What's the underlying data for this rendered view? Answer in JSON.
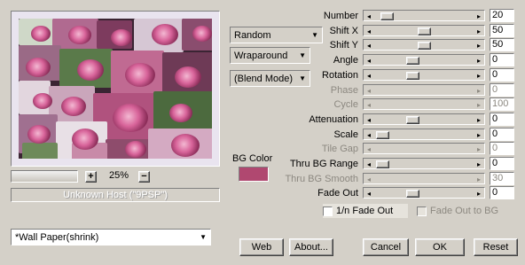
{
  "preview": {
    "zoom": "25%",
    "host_status": "Unknown Host (\"9PSP\")"
  },
  "controls": {
    "mode": "Random",
    "edge": "Wraparound",
    "blend": "(Blend Mode)",
    "bg_color_label": "BG Color",
    "bg_color": "#b04870",
    "preset": "*Wall Paper(shrink)"
  },
  "params": [
    {
      "label": "Number",
      "value": "20",
      "level": 0.05,
      "enabled": true
    },
    {
      "label": "Shift X",
      "value": "50",
      "level": 0.5,
      "enabled": true
    },
    {
      "label": "Shift Y",
      "value": "50",
      "level": 0.5,
      "enabled": true
    },
    {
      "label": "Angle",
      "value": "0",
      "level": 0.37,
      "enabled": true
    },
    {
      "label": "Rotation",
      "value": "0",
      "level": 0.37,
      "enabled": true
    },
    {
      "label": "Phase",
      "value": "0",
      "level": null,
      "enabled": false
    },
    {
      "label": "Cycle",
      "value": "100",
      "level": null,
      "enabled": false
    },
    {
      "label": "Attenuation",
      "value": "0",
      "level": 0.37,
      "enabled": true
    },
    {
      "label": "Scale",
      "value": "0",
      "level": 0.0,
      "enabled": true
    },
    {
      "label": "Tile Gap",
      "value": "0",
      "level": null,
      "enabled": false
    },
    {
      "label": "Thru BG Range",
      "value": "0",
      "level": 0.0,
      "enabled": true
    },
    {
      "label": "Thru BG Smooth",
      "value": "30",
      "level": null,
      "enabled": false
    },
    {
      "label": "Fade Out",
      "value": "0",
      "level": 0.37,
      "enabled": true
    }
  ],
  "checkboxes": {
    "fade_1n": "1/n Fade Out",
    "fade_to_bg": "Fade Out to BG"
  },
  "buttons": {
    "web": "Web",
    "about": "About...",
    "cancel": "Cancel",
    "ok": "OK",
    "reset": "Reset"
  }
}
